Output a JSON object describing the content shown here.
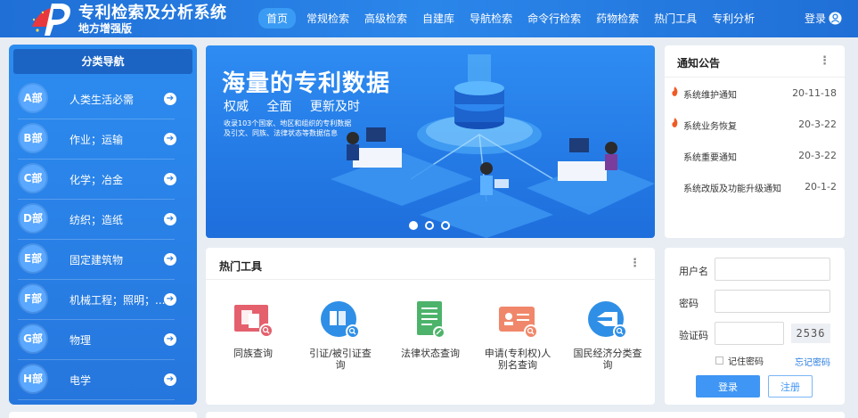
{
  "header": {
    "title": "专利检索及分析系统",
    "subtitle": "地方增强版",
    "nav": [
      "首页",
      "常规检索",
      "高级检索",
      "自建库",
      "导航检索",
      "命令行检索",
      "药物检索",
      "热门工具",
      "专利分析"
    ],
    "login": "登录"
  },
  "category": {
    "title": "分类导航",
    "items": [
      {
        "code": "A部",
        "label": "人类生活必需"
      },
      {
        "code": "B部",
        "label": "作业；运输"
      },
      {
        "code": "C部",
        "label": "化学；冶金"
      },
      {
        "code": "D部",
        "label": "纺织；造纸"
      },
      {
        "code": "E部",
        "label": "固定建筑物"
      },
      {
        "code": "F部",
        "label": "机械工程；照明；..."
      },
      {
        "code": "G部",
        "label": "物理"
      },
      {
        "code": "H部",
        "label": "电学"
      }
    ],
    "arrow": "➔"
  },
  "banner": {
    "title": "海量的专利数据",
    "tags": [
      "权威",
      "全面",
      "更新及时"
    ],
    "desc": "收录103个国家、地区和组织的专利数据及引文、同族、法律状态等数据信息"
  },
  "notice": {
    "title": "通知公告",
    "more": "⋮",
    "items": [
      {
        "text": "系统维护通知",
        "date": "20-11-18",
        "hot": true
      },
      {
        "text": "系统业务恢复",
        "date": "20-3-22",
        "hot": true
      },
      {
        "text": "系统重要通知",
        "date": "20-3-22",
        "hot": false
      },
      {
        "text": "系统改版及功能升级通知",
        "date": "20-1-2",
        "hot": false
      }
    ]
  },
  "tools": {
    "title": "热门工具",
    "more": "⋮",
    "items": [
      {
        "label": "同族查询"
      },
      {
        "label": "引证/被引证查询"
      },
      {
        "label": "法律状态查询"
      },
      {
        "label": "申请(专利权)人别名查询"
      },
      {
        "label": "国民经济分类查询"
      }
    ]
  },
  "login": {
    "username_label": "用户名",
    "password_label": "密码",
    "captcha_label": "验证码",
    "captcha_text": "2536",
    "remember": "记住密码",
    "forgot": "忘记密码",
    "login_button": "登录",
    "register_button": "注册"
  },
  "colors": {
    "header_bg": "#2b86ea",
    "panel_blue": "#2d8cf0",
    "accent": "#3f96f4",
    "hot": "#f05a24"
  }
}
